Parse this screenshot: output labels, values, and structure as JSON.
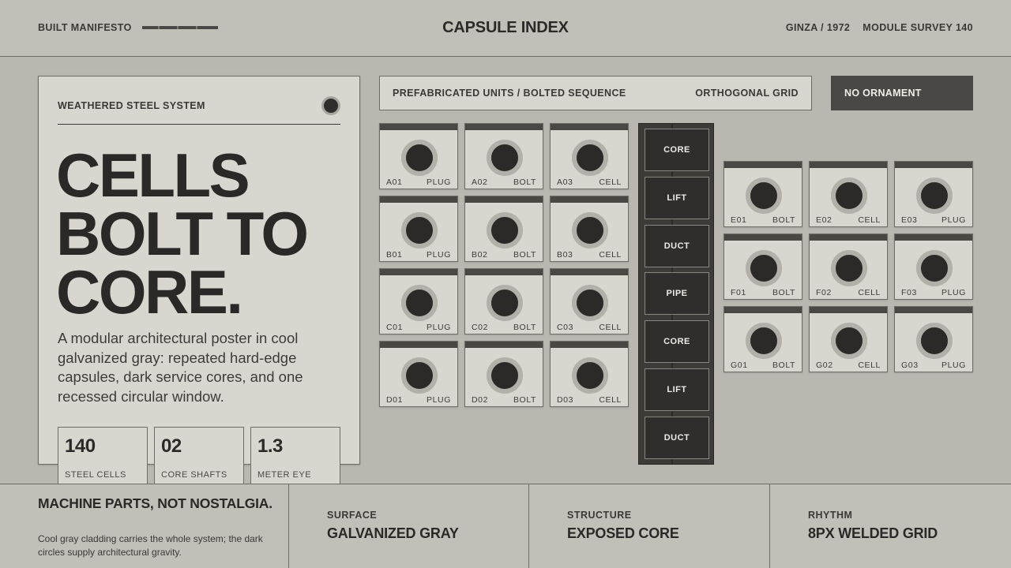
{
  "header": {
    "left_label": "BUILT MANIFESTO",
    "title": "CAPSULE INDEX",
    "right_items": [
      "GINZA / 1972",
      "MODULE SURVEY 140"
    ]
  },
  "card": {
    "label": "WEATHERED STEEL SYSTEM",
    "headline": [
      "CELLS",
      "BOLT TO",
      "CORE."
    ],
    "description": "A modular architectural poster in cool galvanized gray: repeated hard-edge capsules, dark service cores, and one recessed circular window.",
    "stats": [
      {
        "value": "140",
        "label": "STEEL CELLS"
      },
      {
        "value": "02",
        "label": "CORE SHAFTS"
      },
      {
        "value": "1.3",
        "label": "METER EYE"
      }
    ]
  },
  "strip": {
    "left": "PREFABRICATED UNITS / BOLTED SEQUENCE",
    "right": "ORTHOGONAL GRID"
  },
  "tag": "NO ORNAMENT",
  "left_grid": [
    {
      "id": "A01",
      "type": "PLUG"
    },
    {
      "id": "A02",
      "type": "BOLT"
    },
    {
      "id": "A03",
      "type": "CELL"
    },
    {
      "id": "B01",
      "type": "PLUG"
    },
    {
      "id": "B02",
      "type": "BOLT"
    },
    {
      "id": "B03",
      "type": "CELL"
    },
    {
      "id": "C01",
      "type": "PLUG"
    },
    {
      "id": "C02",
      "type": "BOLT"
    },
    {
      "id": "C03",
      "type": "CELL"
    },
    {
      "id": "D01",
      "type": "PLUG"
    },
    {
      "id": "D02",
      "type": "BOLT"
    },
    {
      "id": "D03",
      "type": "CELL"
    }
  ],
  "core_blocks": [
    "CORE",
    "LIFT",
    "DUCT",
    "PIPE",
    "CORE",
    "LIFT",
    "DUCT"
  ],
  "right_grid": [
    {
      "id": "E01",
      "type": "BOLT"
    },
    {
      "id": "E02",
      "type": "CELL"
    },
    {
      "id": "E03",
      "type": "PLUG"
    },
    {
      "id": "F01",
      "type": "BOLT"
    },
    {
      "id": "F02",
      "type": "CELL"
    },
    {
      "id": "F03",
      "type": "PLUG"
    },
    {
      "id": "G01",
      "type": "BOLT"
    },
    {
      "id": "G02",
      "type": "CELL"
    },
    {
      "id": "G03",
      "type": "PLUG"
    }
  ],
  "footer": {
    "headline": "MACHINE PARTS, NOT NOSTALGIA.",
    "text": "Cool gray cladding carries the whole system; the dark circles supply architectural gravity.",
    "specs": [
      {
        "key": "SURFACE",
        "value": "GALVANIZED GRAY"
      },
      {
        "key": "STRUCTURE",
        "value": "EXPOSED CORE"
      },
      {
        "key": "RHYTHM",
        "value": "8PX WELDED GRID"
      }
    ]
  }
}
